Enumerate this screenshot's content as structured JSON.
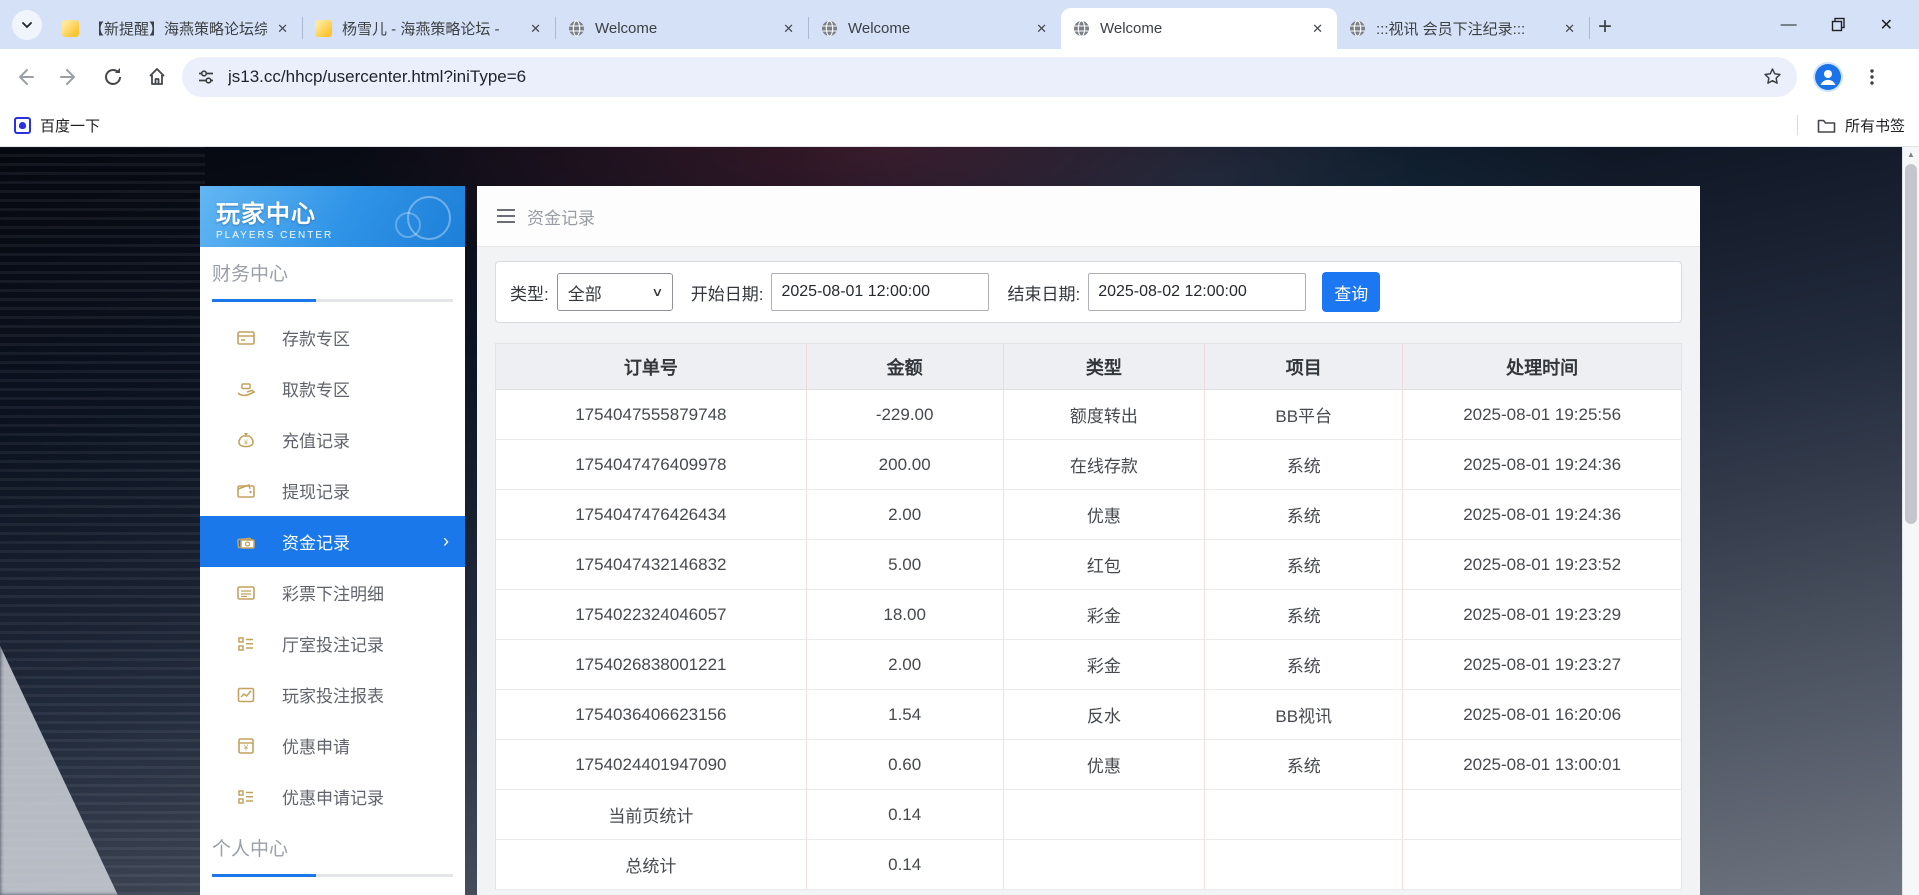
{
  "browser": {
    "tabs": [
      {
        "title": "【新提醒】海燕策略论坛综",
        "icon": "page-yellow",
        "active": false
      },
      {
        "title": "杨雪儿 - 海燕策略论坛 -",
        "icon": "page-yellow",
        "active": false
      },
      {
        "title": "Welcome",
        "icon": "globe",
        "active": false
      },
      {
        "title": "Welcome",
        "icon": "globe",
        "active": false
      },
      {
        "title": "Welcome",
        "icon": "globe",
        "active": true
      },
      {
        "title": ":::视讯 会员下注纪录:::",
        "icon": "globe",
        "active": false
      }
    ],
    "new_tab_label": "+",
    "window_controls": {
      "minimize": "—",
      "close": "✕"
    },
    "url": "js13.cc/hhcp/usercenter.html?iniType=6",
    "bookmark_left": "百度一下",
    "bookmark_right": "所有书签"
  },
  "sidebar": {
    "title": "玩家中心",
    "subtitle": "PLAYERS CENTER",
    "sections": [
      {
        "label": "财务中心",
        "items": [
          {
            "label": "存款专区",
            "icon": "deposit-card-icon",
            "active": false
          },
          {
            "label": "取款专区",
            "icon": "withdraw-hand-icon",
            "active": false
          },
          {
            "label": "充值记录",
            "icon": "moneybag-icon",
            "active": false
          },
          {
            "label": "提现记录",
            "icon": "wallet-icon",
            "active": false
          },
          {
            "label": "资金记录",
            "icon": "banknote-icon",
            "active": true
          },
          {
            "label": "彩票下注明细",
            "icon": "note-icon",
            "active": false
          },
          {
            "label": "厅室投注记录",
            "icon": "list-icon",
            "active": false
          },
          {
            "label": "玩家投注报表",
            "icon": "chart-icon",
            "active": false
          },
          {
            "label": "优惠申请",
            "icon": "coupon-icon",
            "active": false
          },
          {
            "label": "优惠申请记录",
            "icon": "list-icon",
            "active": false
          }
        ]
      },
      {
        "label": "个人中心",
        "items": []
      }
    ],
    "active_chevron": "›"
  },
  "main": {
    "page_title": "资金记录",
    "filter": {
      "type_label": "类型:",
      "type_value": "全部",
      "start_label": "开始日期:",
      "start_value": "2025-08-01 12:00:00",
      "end_label": "结束日期:",
      "end_value": "2025-08-02 12:00:00",
      "search_label": "查询"
    },
    "table": {
      "headers": [
        "订单号",
        "金额",
        "类型",
        "项目",
        "处理时间"
      ],
      "col_widths_pct": [
        26.2,
        16.6,
        17.0,
        16.7,
        23.5
      ],
      "rows": [
        [
          "1754047555879748",
          "-229.00",
          "额度转出",
          "BB平台",
          "2025-08-01 19:25:56"
        ],
        [
          "1754047476409978",
          "200.00",
          "在线存款",
          "系统",
          "2025-08-01 19:24:36"
        ],
        [
          "1754047476426434",
          "2.00",
          "优惠",
          "系统",
          "2025-08-01 19:24:36"
        ],
        [
          "1754047432146832",
          "5.00",
          "红包",
          "系统",
          "2025-08-01 19:23:52"
        ],
        [
          "1754022324046057",
          "18.00",
          "彩金",
          "系统",
          "2025-08-01 19:23:29"
        ],
        [
          "1754026838001221",
          "2.00",
          "彩金",
          "系统",
          "2025-08-01 19:23:27"
        ],
        [
          "1754036406623156",
          "1.54",
          "反水",
          "BB视讯",
          "2025-08-01 16:20:06"
        ],
        [
          "1754024401947090",
          "0.60",
          "优惠",
          "系统",
          "2025-08-01 13:00:01"
        ],
        [
          "当前页统计",
          "0.14",
          "",
          "",
          ""
        ],
        [
          "总统计",
          "0.14",
          "",
          "",
          ""
        ]
      ]
    }
  },
  "colors": {
    "accent_blue": "#1a78ea",
    "button_blue": "#1c77f2",
    "gold_icon": "#c3a25e",
    "table_divider_pink": "#f4dede",
    "tabstrip_bg": "#d5e1f7"
  }
}
